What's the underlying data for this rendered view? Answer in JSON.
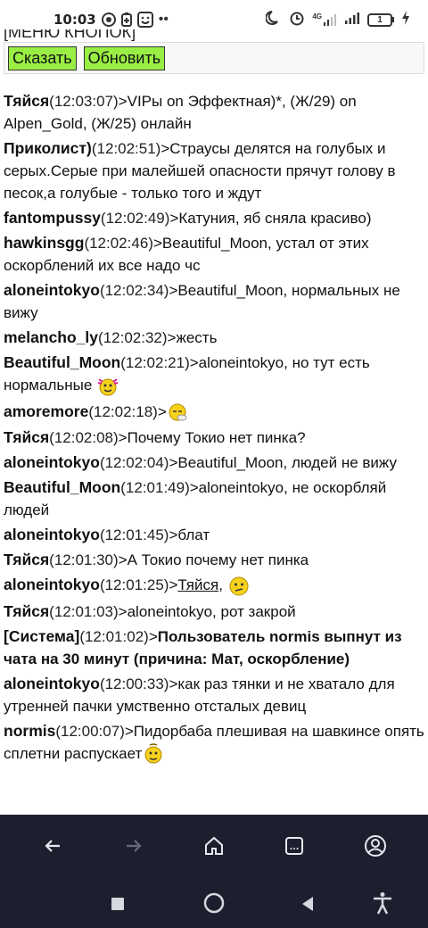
{
  "statusbar": {
    "time": "10:03",
    "network": "4G",
    "battery": "1"
  },
  "menu": {
    "header": "[МЕНЮ КНОПОК]",
    "say_label": "Сказать",
    "refresh_label": "Обновить"
  },
  "messages": [
    {
      "nick": "Тяйся",
      "time": "(12:03:07)",
      "text": ">VIPы on Эффектная)*, (Ж/29) on Alpen_Gold, (Ж/25) онлайн"
    },
    {
      "nick": "Приколист)",
      "time": "(12:02:51)",
      "text": ">Страусы делятся на голубых и серых.Серые при малейшей опасности прячут голову в песок,а голубые - только того и ждут"
    },
    {
      "nick": "fantompussy",
      "time": "(12:02:49)",
      "text": ">Катуния, яб сняла красиво)"
    },
    {
      "nick": "hawkinsgg",
      "time": "(12:02:46)",
      "text": ">Beautiful_Moon, устал от этих оскорблений их все надо чс"
    },
    {
      "nick": "aloneintokyo",
      "time": "(12:02:34)",
      "text": ">Beautiful_Moon, нормальных не вижу"
    },
    {
      "nick": "melancho_ly",
      "time": "(12:02:32)",
      "text": ">жесть"
    },
    {
      "nick": "Beautiful_Moon",
      "time": "(12:02:21)",
      "text": ">aloneintokyo, но тут есть нормальные "
    },
    {
      "nick": "amoremore",
      "time": "(12:02:18)",
      "text": ">"
    },
    {
      "nick": "Тяйся",
      "time": "(12:02:08)",
      "text": ">Почему Токио нет пинка?"
    },
    {
      "nick": "aloneintokyo",
      "time": "(12:02:04)",
      "text": ">Beautiful_Moon, людей не вижу"
    },
    {
      "nick": "Beautiful_Moon",
      "time": "(12:01:49)",
      "text": ">aloneintokyo, не оскорбляй людей"
    },
    {
      "nick": "aloneintokyo",
      "time": "(12:01:45)",
      "text": ">блат"
    },
    {
      "nick": "Тяйся",
      "time": "(12:01:30)",
      "text": ">А Токио почему нет пинка"
    },
    {
      "nick": "aloneintokyo",
      "time": "(12:01:25)",
      "text": ">",
      "link": "Тяйся",
      "after": ", "
    },
    {
      "nick": "Тяйся",
      "time": "(12:01:03)",
      "text": ">aloneintokyo, рот закрой"
    },
    {
      "nick": "[Система]",
      "time": "(12:01:02)",
      "text": ">",
      "bold_text": "Пользователь normis выпнут из чата на 30 минут (причина: Мат, оскорбление)"
    },
    {
      "nick": "aloneintokyo",
      "time": "(12:00:33)",
      "text": ">как раз тянки и не хватало для утренней пачки умственно отсталых девиц"
    },
    {
      "nick": "normis",
      "time": "(12:00:07)",
      "text": ">Пидорбаба плешивая на шавкинсе опять сплетни распускает"
    }
  ]
}
